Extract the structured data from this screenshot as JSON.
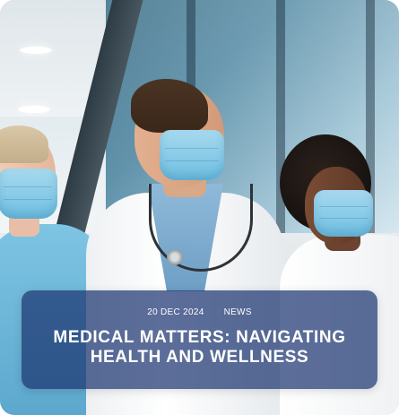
{
  "article": {
    "date": "20 DEC 2024",
    "category": "NEWS",
    "title": "MEDICAL MATTERS: NAVIGATING HEALTH AND WELLNESS"
  },
  "colors": {
    "caption_bg": "#1c3470",
    "mask": "#7cc6e6",
    "text": "#ffffff"
  }
}
